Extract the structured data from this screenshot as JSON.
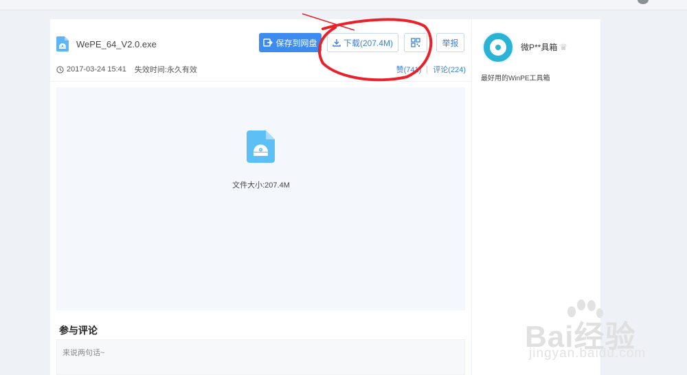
{
  "file": {
    "name": "WePE_64_V2.0.exe",
    "date": "2017-03-24 15:41",
    "expiry_label": "失效时间:",
    "expiry_value": "永久有效",
    "size_text": "文件大小:207.4M"
  },
  "actions": {
    "save_label": "保存到网盘",
    "download_label": "下载(207.4M)",
    "report_label": "举报",
    "qr_icon": "qrcode-icon"
  },
  "stats": {
    "likes": "赞(741)",
    "comments": "评论(224)"
  },
  "comments": {
    "title": "参与评论",
    "placeholder": "来说两句话~"
  },
  "user": {
    "name": "微P**具箱",
    "description": "最好用的WinPE工具箱"
  },
  "watermark": {
    "main": "Bai经验",
    "sub": "jingyan.baidu.com"
  },
  "colors": {
    "accent": "#3d8bef",
    "link": "#3b7fd6",
    "annotation": "#e8212a",
    "file_icon": "#5cb6f5"
  }
}
